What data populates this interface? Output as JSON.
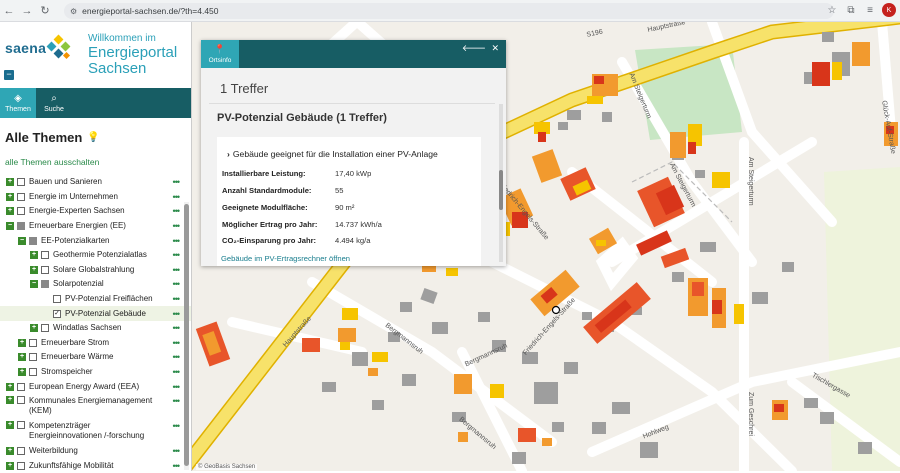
{
  "browser": {
    "url": "energieportal-sachsen.de/?th=4.450",
    "profile_initial": "K"
  },
  "brand": {
    "logo_text": "saena",
    "title_line1": "Willkommen im",
    "title_line2": "Energieportal",
    "title_line3": "Sachsen"
  },
  "tabs": [
    {
      "label": "Themen",
      "icon": "layers-icon"
    },
    {
      "label": "Suche",
      "icon": "search-icon"
    }
  ],
  "sidebar": {
    "heading": "Alle Themen",
    "toggle_all": "alle Themen ausschalten",
    "items": [
      {
        "label": "Bauen und Sanieren"
      },
      {
        "label": "Energie im Unternehmen"
      },
      {
        "label": "Energie-Experten Sachsen"
      },
      {
        "label": "Erneuerbare Energien (EE)"
      },
      {
        "label": "EE-Potenzialkarten"
      },
      {
        "label": "Geothermie Potenzialatlas"
      },
      {
        "label": "Solare Globalstrahlung"
      },
      {
        "label": "Solarpotenzial"
      },
      {
        "label": "PV-Potenzial Freiflächen"
      },
      {
        "label": "PV-Potenzial Gebäude"
      },
      {
        "label": "Windatlas Sachsen"
      },
      {
        "label": "Erneuerbare Strom"
      },
      {
        "label": "Erneuerbare Wärme"
      },
      {
        "label": "Stromspeicher"
      },
      {
        "label": "European Energy Award (EEA)"
      },
      {
        "label": "Kommunales Energiemanagement (KEM)"
      },
      {
        "label": "Kompetenzträger Energieinnovationen /-forschung"
      },
      {
        "label": "Weiterbildung"
      },
      {
        "label": "Zukunftsfähige Mobilität"
      }
    ]
  },
  "popup": {
    "tab_label": "Ortsinfo",
    "hits": "1 Treffer",
    "result_title": "PV-Potenzial Gebäude (1 Treffer)",
    "card_heading": "Gebäude geeignet für die Installation einer PV-Anlage",
    "fields": [
      {
        "key": "Installierbare Leistung:",
        "value": "17,40 kWp"
      },
      {
        "key": "Anzahl Standardmodule:",
        "value": "55"
      },
      {
        "key": "Geeignete Modulfläche:",
        "value": "90 m²"
      },
      {
        "key": "Möglicher Ertrag pro Jahr:",
        "value": "14.737 kWh/a"
      },
      {
        "key": "CO₂-Einsparung pro Jahr:",
        "value": "4.494 kg/a"
      }
    ],
    "link": "Gebäude im PV-Ertragsrechner öffnen"
  },
  "map": {
    "streets": [
      {
        "name": "Hauptstraße",
        "angle": -12
      },
      {
        "name": "S196",
        "angle": -12
      },
      {
        "name": "Am Steigerturm",
        "angle": 68
      },
      {
        "name": "Am Steigerturm",
        "angle": 90
      },
      {
        "name": "Am Steigerturm",
        "angle": 62
      },
      {
        "name": "Friedrich-Engels-Straße",
        "angle": 50
      },
      {
        "name": "Friedrich-Engels-Straße",
        "angle": -48
      },
      {
        "name": "Hauptstraße",
        "angle": -48
      },
      {
        "name": "Bergmannsruh",
        "angle": 38
      },
      {
        "name": "Bergmannsruh",
        "angle": -25
      },
      {
        "name": "Bergmannsruh",
        "angle": 40
      },
      {
        "name": "Hohlweg",
        "angle": -22
      },
      {
        "name": "Zum Geschrei",
        "angle": 90
      },
      {
        "name": "Tischlergasse",
        "angle": 30
      },
      {
        "name": "Glück-Auf-Straße",
        "angle": 80
      }
    ],
    "copyright": "© GeoBasis Sachsen"
  }
}
